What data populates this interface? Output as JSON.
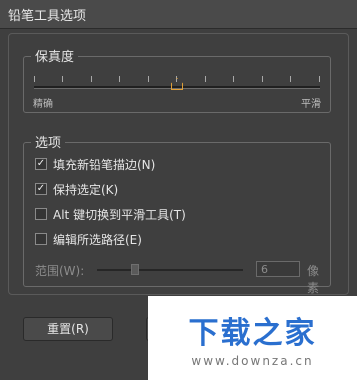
{
  "window": {
    "title": "铅笔工具选项"
  },
  "fidelity": {
    "label": "保真度",
    "min_label": "精确",
    "max_label": "平滑",
    "value_fraction": 0.5
  },
  "options": {
    "label": "选项",
    "items": [
      {
        "label": "填充新铅笔描边(N)",
        "checked": true
      },
      {
        "label": "保持选定(K)",
        "checked": true
      },
      {
        "label": "Alt 键切换到平滑工具(T)",
        "checked": false
      },
      {
        "label": "编辑所选路径(E)",
        "checked": false
      }
    ],
    "range": {
      "label": "范围(W):",
      "value": "6",
      "unit": "像素"
    }
  },
  "buttons": {
    "reset": "重置(R)"
  },
  "watermark": {
    "title": "下载之家",
    "url": "www.downza.cn"
  },
  "colors": {
    "accent": "#e0a038",
    "background": "#3f3f3f"
  }
}
